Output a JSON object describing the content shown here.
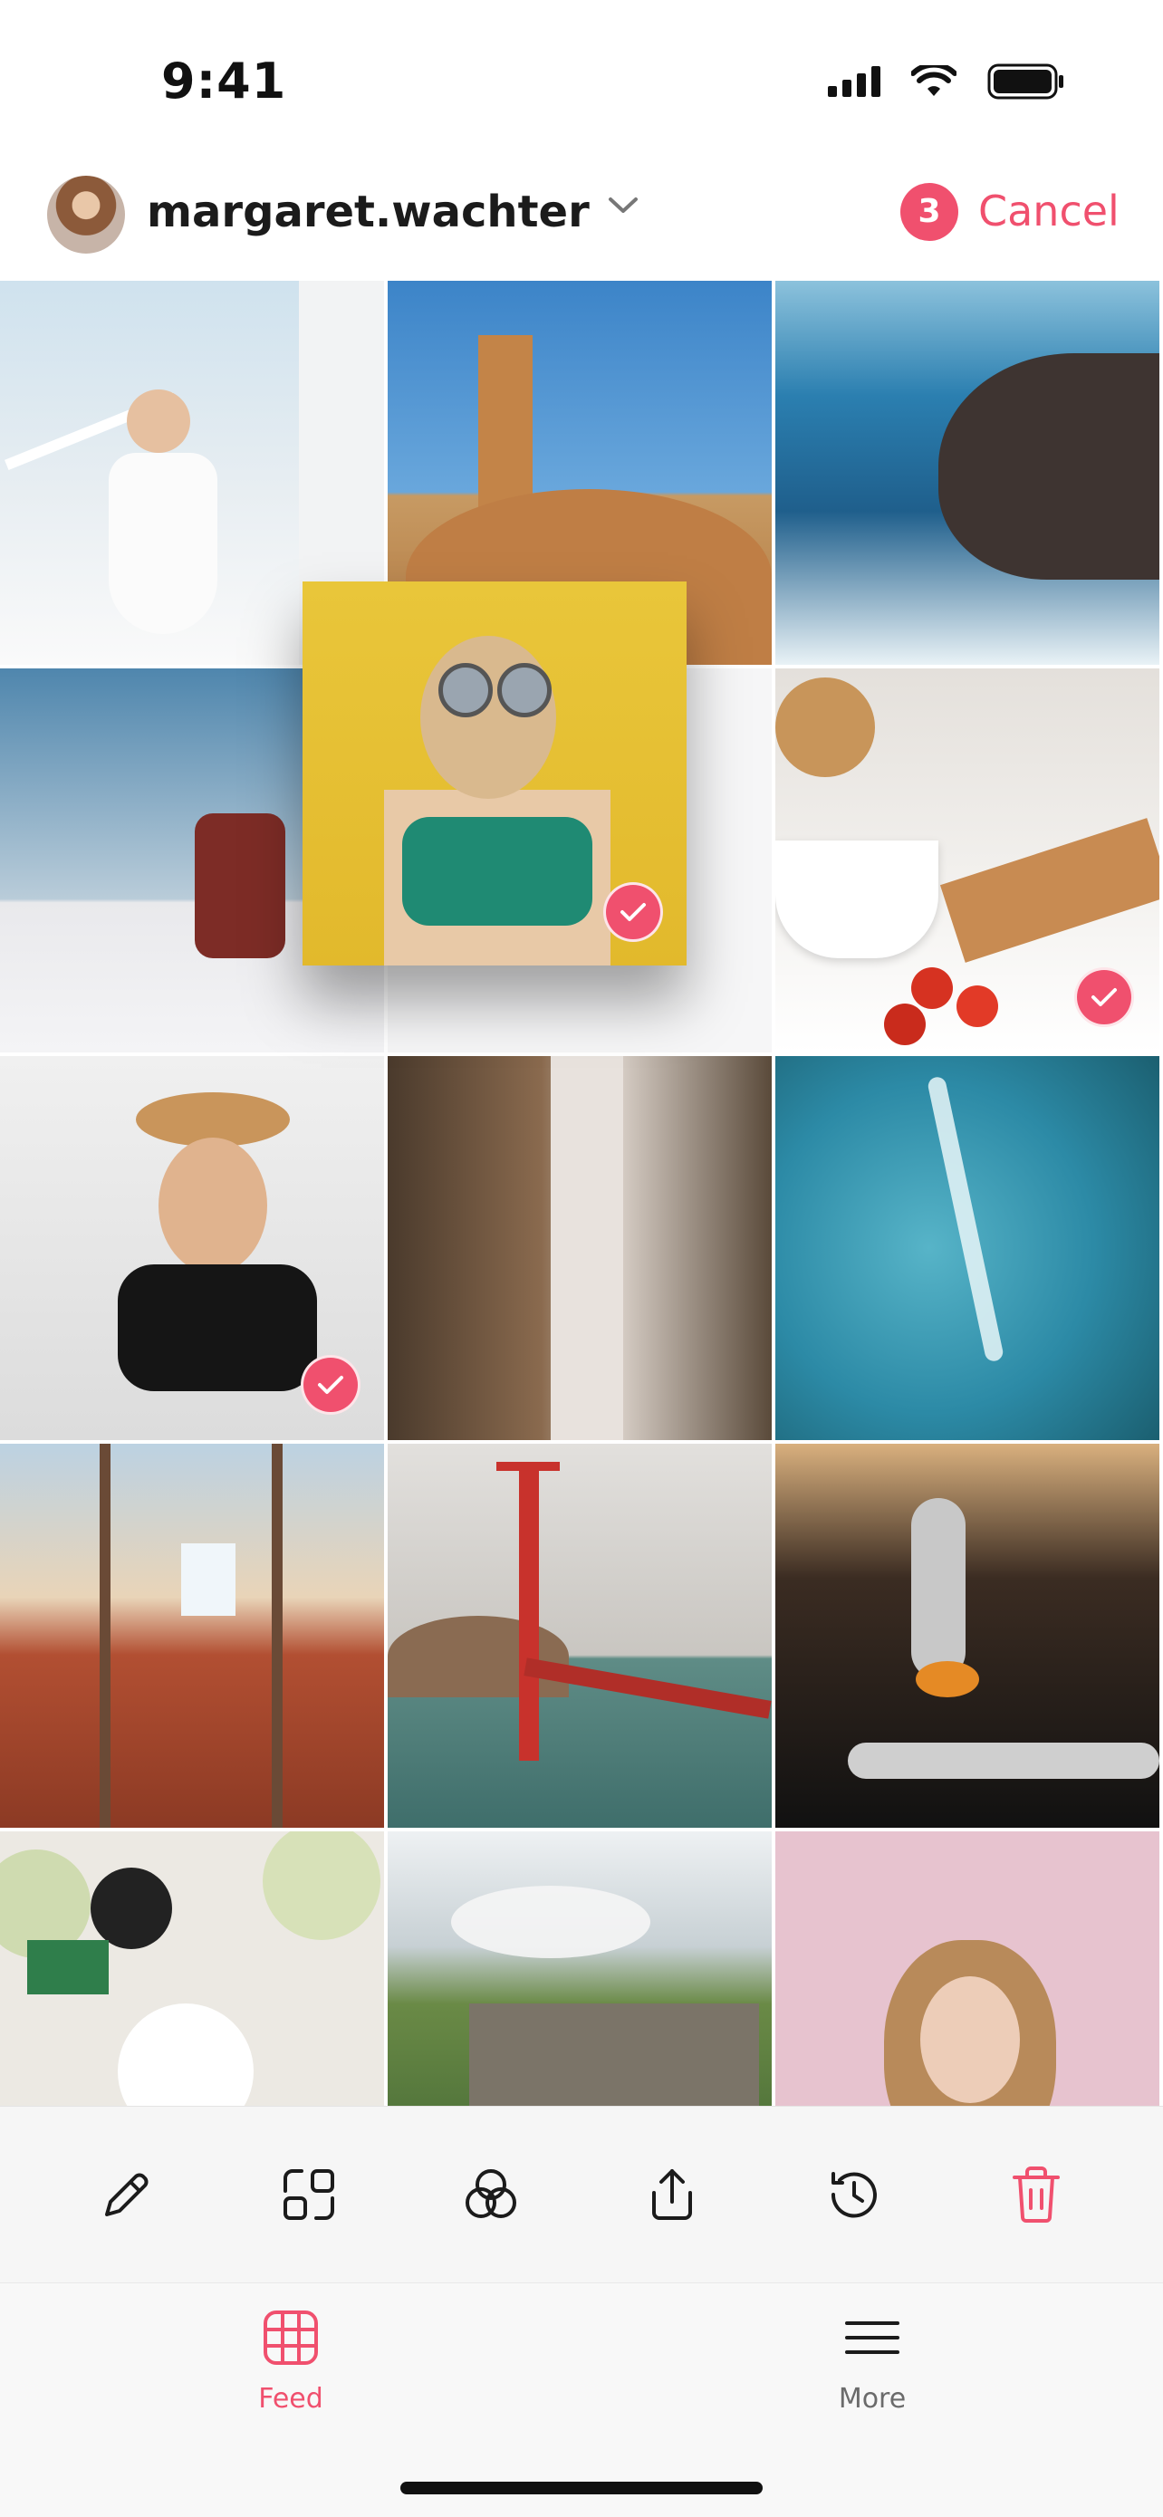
{
  "status": {
    "time": "9:41"
  },
  "header": {
    "username": "margaret.wachter",
    "selected_count": "3",
    "cancel_label": "Cancel"
  },
  "colors": {
    "accent": "#f0506e",
    "text": "#1b1b1b",
    "muted": "#6b6b6b"
  },
  "grid": {
    "photos": [
      {
        "name": "woman-white-dress-stairs",
        "selected": false
      },
      {
        "name": "plaza-de-espana-building",
        "selected": false
      },
      {
        "name": "ocean-waves-rocks",
        "selected": false
      },
      {
        "name": "woman-desert-blanket",
        "selected": false
      },
      {
        "name": "woman-yellow-wall-sunglasses",
        "selected": true,
        "dragging": true
      },
      {
        "name": "cooking-tomatoes-board",
        "selected": true
      },
      {
        "name": "woman-straw-hat",
        "selected": true
      },
      {
        "name": "narrow-street-buildings",
        "selected": false
      },
      {
        "name": "aerial-boat-water",
        "selected": false
      },
      {
        "name": "roof-tiles-window",
        "selected": false
      },
      {
        "name": "golden-gate-bridge",
        "selected": false
      },
      {
        "name": "vintage-car-taillight",
        "selected": false
      },
      {
        "name": "food-table-plates",
        "selected": false
      },
      {
        "name": "train-viaduct-hills",
        "selected": false
      },
      {
        "name": "woman-pink-background",
        "selected": false
      }
    ]
  },
  "toolbar": {
    "icons": [
      "edit-icon",
      "arrange-icon",
      "filters-icon",
      "share-icon",
      "history-icon",
      "delete-icon"
    ]
  },
  "tabbar": {
    "feed_label": "Feed",
    "more_label": "More"
  }
}
